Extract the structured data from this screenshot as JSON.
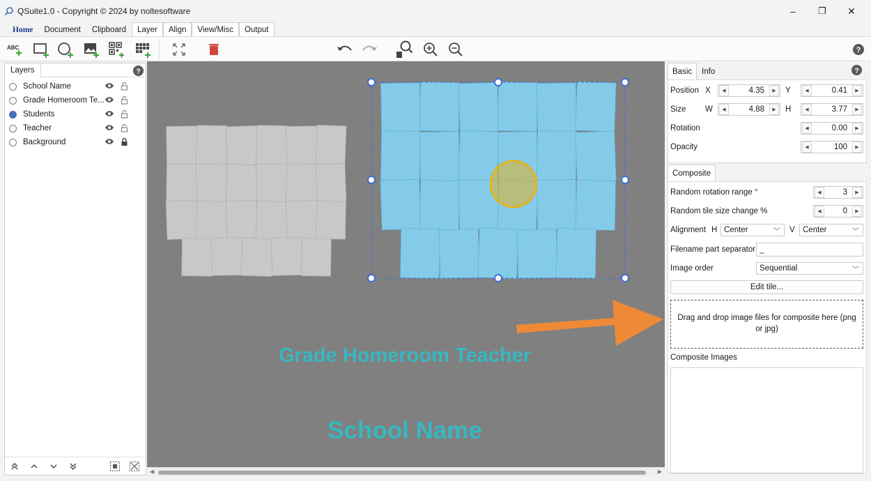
{
  "window": {
    "title": "QSuite1.0 - Copyright © 2024 by noltesoftware",
    "controls": {
      "minimize": "–",
      "restore": "❐",
      "close": "✕"
    }
  },
  "menu": {
    "tabs": [
      "Home",
      "Document",
      "Clipboard",
      "Layer",
      "Align",
      "View/Misc",
      "Output"
    ],
    "active": "Home"
  },
  "toolbar": {
    "text_tool_label": "ABC"
  },
  "layers": {
    "tab_label": "Layers",
    "items": [
      {
        "name": "School Name",
        "selected": false,
        "locked": false
      },
      {
        "name": "Grade Homeroom Te...",
        "selected": false,
        "locked": false
      },
      {
        "name": "Students",
        "selected": true,
        "locked": false
      },
      {
        "name": "Teacher",
        "selected": false,
        "locked": false
      },
      {
        "name": "Background",
        "selected": false,
        "locked": true
      }
    ]
  },
  "canvas": {
    "background_color": "#808080",
    "text_color": "#38b7c0",
    "grade_text": "Grade Homeroom Teacher",
    "school_text": "School Name",
    "grey_tile_color": "#c8c8c8",
    "blue_tile_color": "#84cbe9"
  },
  "properties": {
    "tabs": [
      "Basic",
      "Info"
    ],
    "active_tab": "Basic",
    "position_label": "Position",
    "x_label": "X",
    "x_value": "4.35",
    "y_label": "Y",
    "y_value": "0.41",
    "size_label": "Size",
    "w_label": "W",
    "w_value": "4.88",
    "h_label": "H",
    "h_value": "3.77",
    "rotation_label": "Rotation",
    "rotation_value": "0.00",
    "opacity_label": "Opacity",
    "opacity_value": "100"
  },
  "composite": {
    "tab_label": "Composite",
    "random_rotation_label": "Random rotation range °",
    "random_rotation_value": "3",
    "random_size_label": "Random tile size change %",
    "random_size_value": "0",
    "alignment_label": "Alignment",
    "h_label": "H",
    "h_value": "Center",
    "v_label": "V",
    "v_value": "Center",
    "separator_label": "Filename part separator",
    "separator_value": "_",
    "image_order_label": "Image order",
    "image_order_value": "Sequential",
    "edit_tile_label": "Edit tile...",
    "dropzone_text": "Drag and drop image files for composite here (png or jpg)",
    "images_label": "Composite Images"
  },
  "colors": {
    "accent": "#4a6fb3",
    "arrow": "#ee8a35",
    "circle": "#e2b321",
    "delete": "#d0453c",
    "icon_green": "#3aa336"
  }
}
